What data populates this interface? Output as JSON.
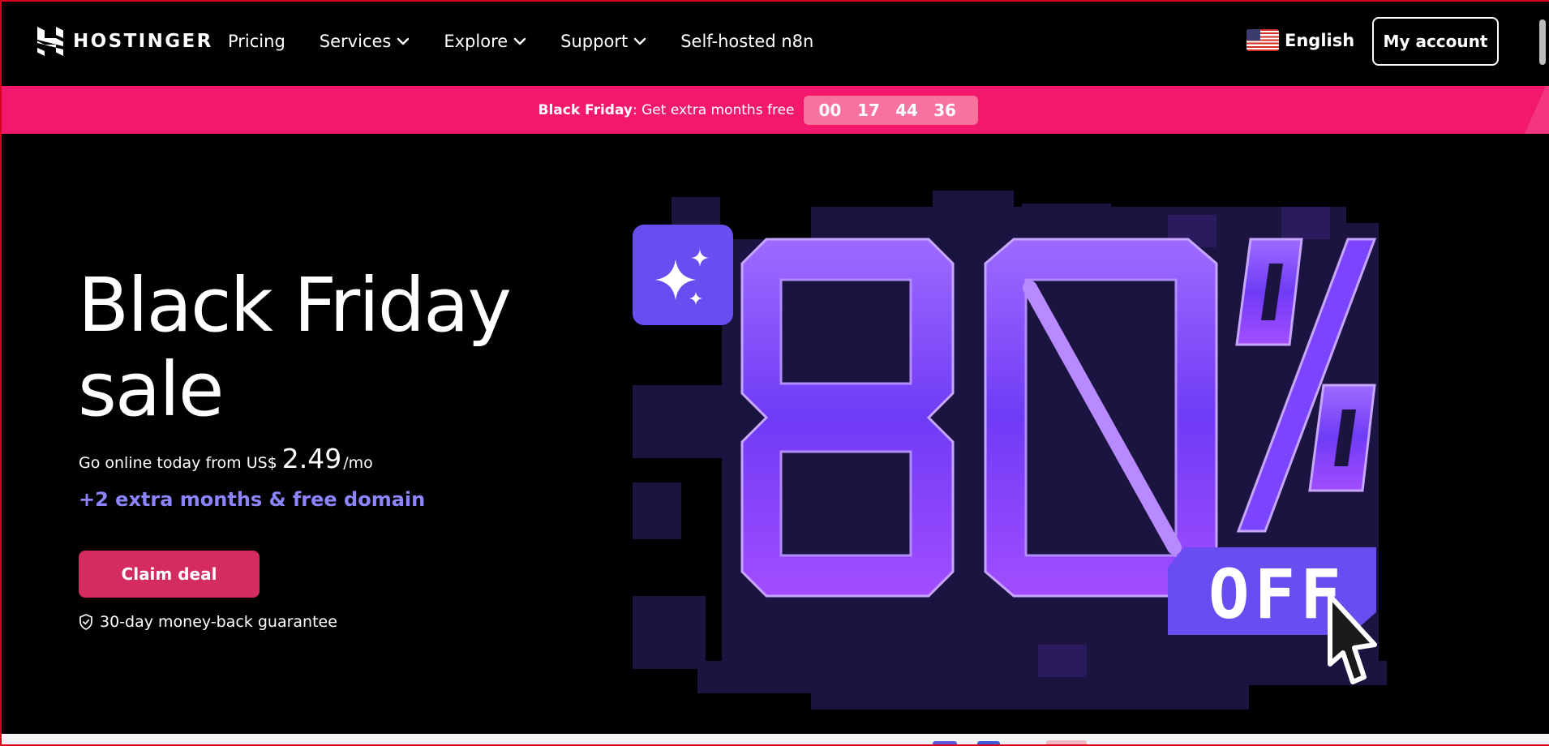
{
  "header": {
    "logo_text": "HOSTINGER",
    "nav": [
      {
        "label": "Pricing",
        "has_dropdown": false
      },
      {
        "label": "Services",
        "has_dropdown": true
      },
      {
        "label": "Explore",
        "has_dropdown": true
      },
      {
        "label": "Support",
        "has_dropdown": true
      },
      {
        "label": "Self-hosted n8n",
        "has_dropdown": false
      }
    ],
    "language": "English",
    "account_button": "My account"
  },
  "promo": {
    "bold": "Black Friday",
    "text": ": Get extra months free",
    "timer": [
      "00",
      "17",
      "44",
      "36"
    ],
    "background_color": "#f2196c"
  },
  "hero": {
    "title_line1": "Black Friday",
    "title_line2": "sale",
    "price_prefix": "Go online today from US$",
    "price_value": "2.49",
    "price_suffix": "/mo",
    "extra": "+2 extra months & free domain",
    "cta": "Claim deal",
    "guarantee": "30-day money-back guarantee",
    "graphic_number": "80",
    "graphic_percent": "%",
    "graphic_off": "OFF",
    "accent_color": "#8c85ff",
    "cta_color": "#d42b61"
  },
  "icons": {
    "logo": "hostinger-logo-icon",
    "flag": "us-flag-icon",
    "dropdown": "chevron-down-icon",
    "guarantee": "shield-check-icon",
    "sparkle": "sparkles-icon",
    "cursor": "cursor-arrow-icon"
  }
}
